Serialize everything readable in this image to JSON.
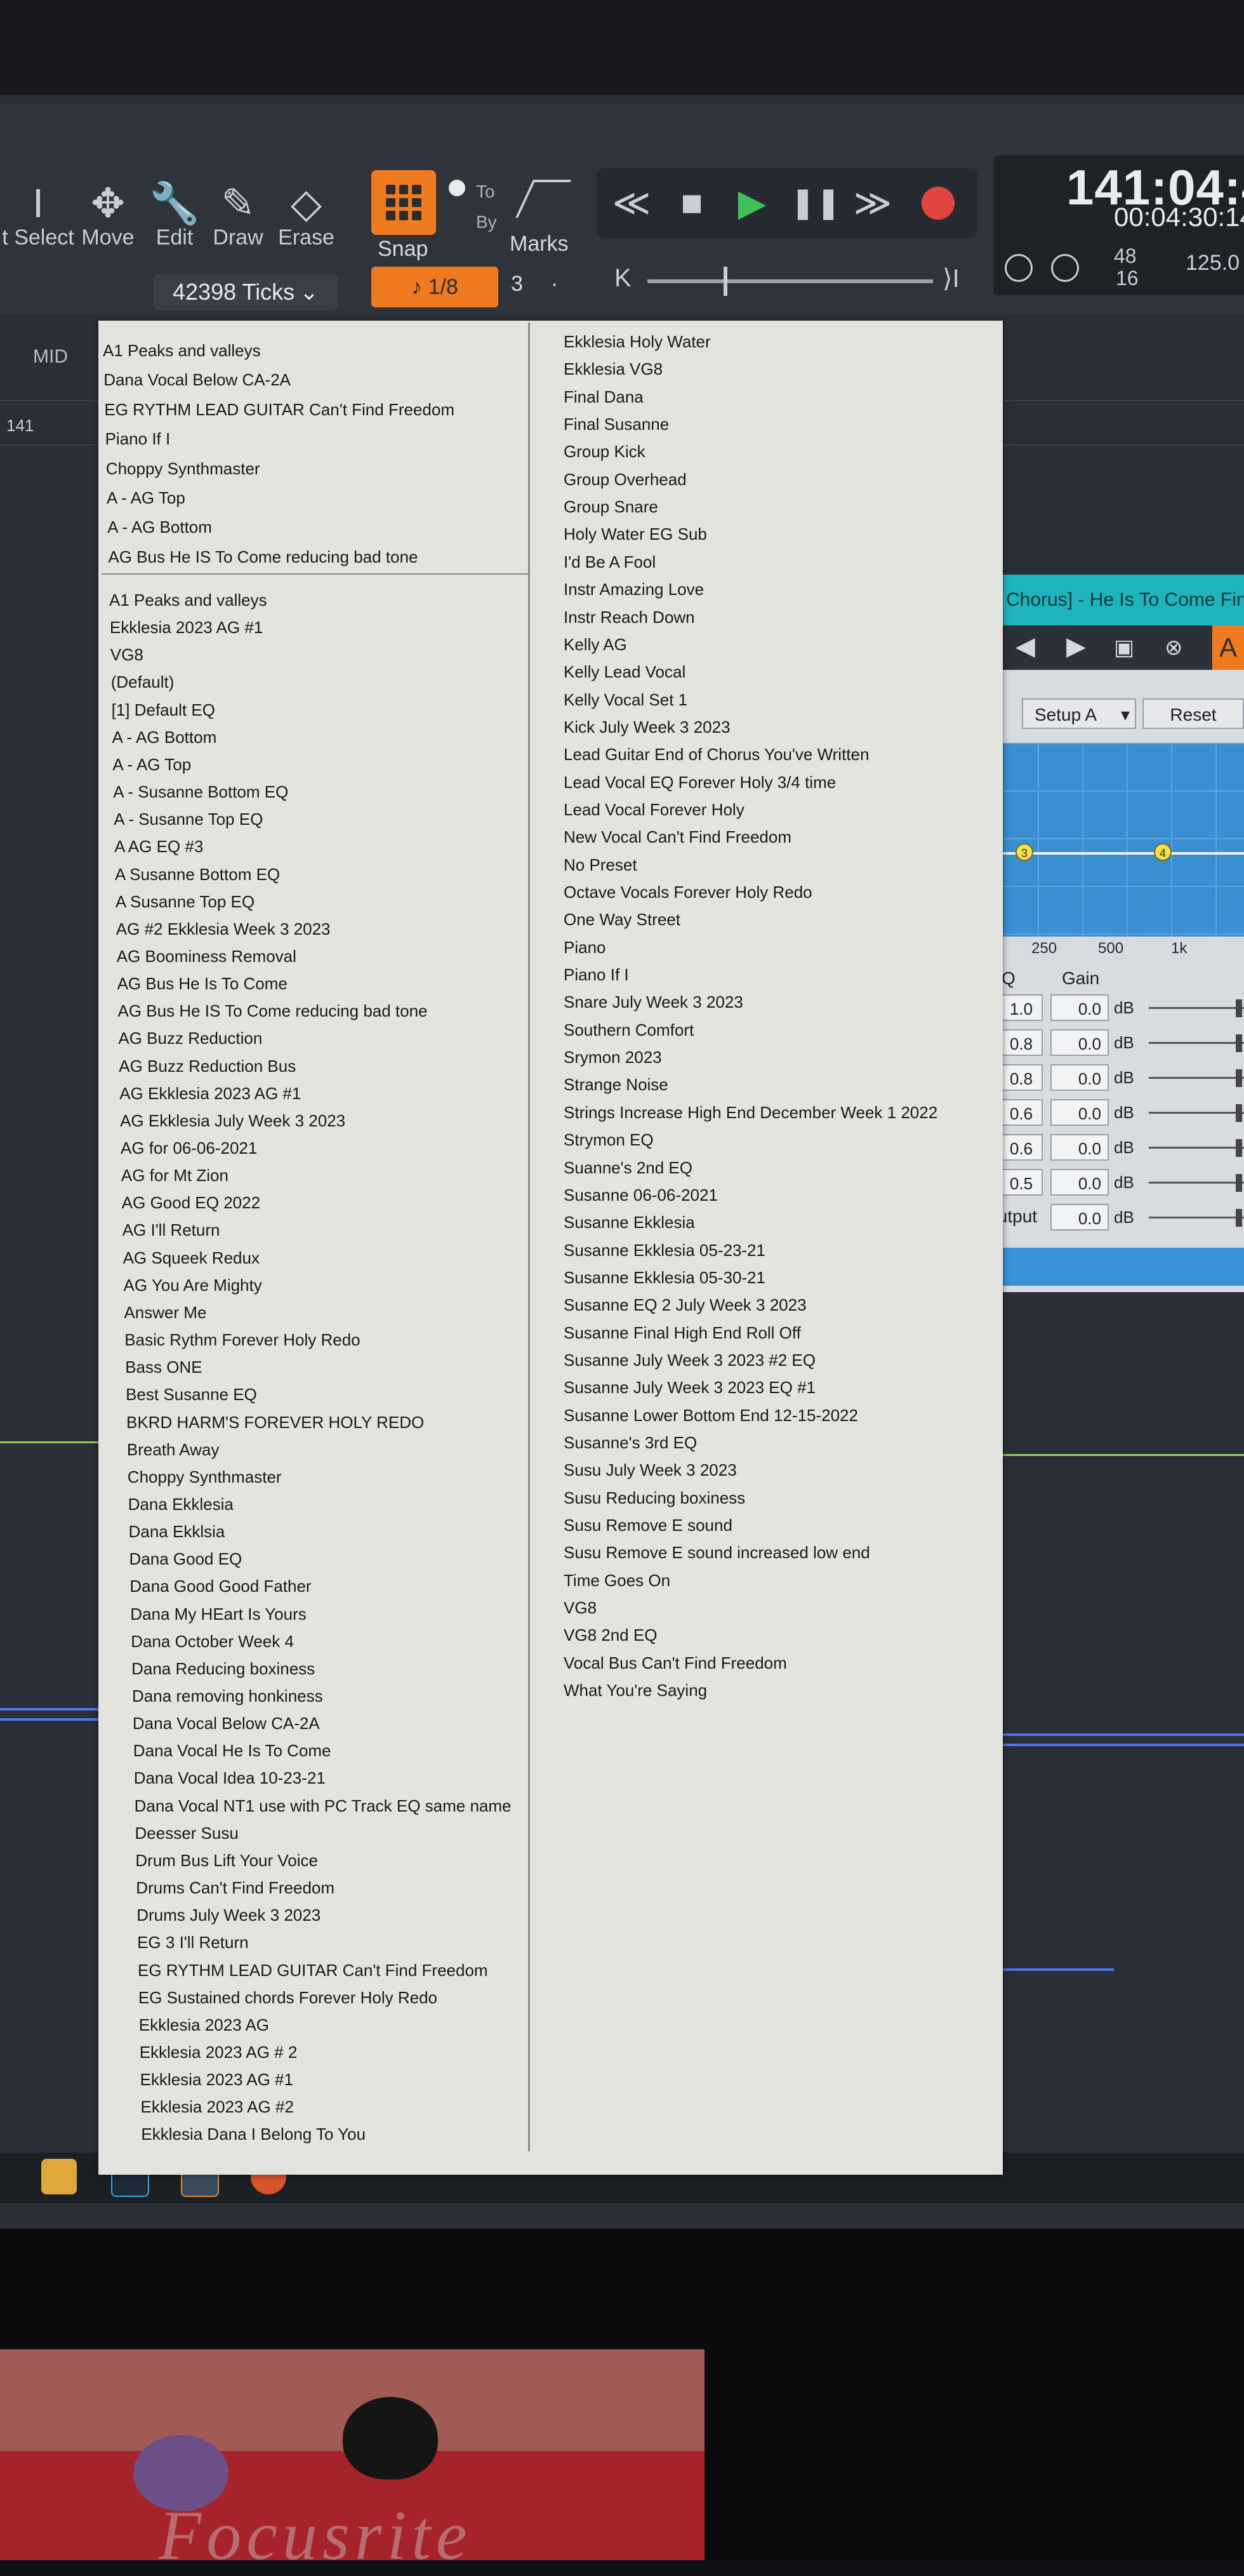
{
  "toolbar": {
    "tools": [
      {
        "label": "t Select",
        "icon": "text-cursor-icon"
      },
      {
        "label": "Move",
        "icon": "move-icon"
      },
      {
        "label": "Edit",
        "icon": "wrench-icon"
      },
      {
        "label": "Draw",
        "icon": "pencil-icon"
      },
      {
        "label": "Erase",
        "icon": "eraser-icon"
      }
    ],
    "snap_label": "Snap",
    "ticks_value": "42398 Ticks",
    "quantize_value": "♪ 1/8",
    "to_label": "To",
    "by_label": "By",
    "marks_label": "Marks",
    "marks_value": "3",
    "marks_dot": "·"
  },
  "transport": {
    "rewind": "≪",
    "stop": "■",
    "play": "▶",
    "pause": "❚❚",
    "fast_forward": "≫",
    "scrub_start": "K",
    "scrub_end": "⟩I"
  },
  "time_display": {
    "bars": "141:04:4",
    "clock": "00:04:30:14",
    "time_sig_top": "48",
    "time_sig_bottom": "16",
    "tempo": "125.0"
  },
  "arrange": {
    "mid_label": "MID",
    "bar_number": "141"
  },
  "eq_window": {
    "title": "Chorus] - He Is To Come Final",
    "setup_label": "Setup A",
    "setup_arrow": "▾",
    "reset_label": "Reset",
    "orange_tab": "A",
    "freq_labels": [
      "250",
      "500",
      "1k"
    ],
    "node_labels": [
      "3",
      "4"
    ],
    "q_header": "Q",
    "gain_header": "Gain",
    "bands": [
      {
        "q": "1.0",
        "gain": "0.0",
        "unit": "dB"
      },
      {
        "q": "0.8",
        "gain": "0.0",
        "unit": "dB"
      },
      {
        "q": "0.8",
        "gain": "0.0",
        "unit": "dB"
      },
      {
        "q": "0.6",
        "gain": "0.0",
        "unit": "dB"
      },
      {
        "q": "0.6",
        "gain": "0.0",
        "unit": "dB"
      },
      {
        "q": "0.5",
        "gain": "0.0",
        "unit": "dB"
      }
    ],
    "output_label": "Output",
    "output_gain": "0.0",
    "output_unit": "dB"
  },
  "menu": {
    "recent": [
      "A1 Peaks and valleys",
      "Dana Vocal Below CA-2A",
      "EG RYTHM  LEAD GUITAR Can't Find Freedom",
      "Piano If I",
      "Choppy Synthmaster",
      "A - AG Top",
      "A - AG Bottom",
      "AG Bus He IS To Come reducing bad tone"
    ],
    "column1": [
      "A1 Peaks and valleys",
      "Ekklesia 2023 AG #1",
      "VG8",
      "(Default)",
      "[1] Default EQ",
      "A - AG Bottom",
      "A - AG Top",
      "A - Susanne Bottom EQ",
      "A - Susanne Top EQ",
      "A AG EQ #3",
      "A Susanne Bottom EQ",
      "A Susanne Top EQ",
      "AG #2 Ekklesia Week 3 2023",
      "AG Boominess Removal",
      "AG Bus He Is To Come",
      "AG Bus He IS To Come reducing bad tone",
      "AG Buzz Reduction",
      "AG Buzz Reduction Bus",
      "AG Ekklesia 2023 AG #1",
      "AG Ekklesia July Week 3 2023",
      "AG for 06-06-2021",
      "AG for Mt Zion",
      "AG Good EQ 2022",
      "AG I'll Return",
      "AG Squeek Redux",
      "AG You Are Mighty",
      "Answer Me",
      "Basic Rythm Forever Holy Redo",
      "Bass ONE",
      "Best Susanne EQ",
      "BKRD HARM'S FOREVER HOLY REDO",
      "Breath Away",
      "Choppy Synthmaster",
      "Dana Ekklesia",
      "Dana Ekklsia",
      "Dana Good EQ",
      "Dana Good Good Father",
      "Dana My HEart Is Yours",
      "Dana October Week 4",
      "Dana Reducing boxiness",
      "Dana removing honkiness",
      "Dana Vocal Below CA-2A",
      "Dana Vocal He Is To Come",
      "Dana Vocal Idea 10-23-21",
      "Dana Vocal NT1 use with PC Track EQ same name",
      "Deesser Susu",
      "Drum Bus Lift Your Voice",
      "Drums Can't Find Freedom",
      "Drums July Week 3 2023",
      "EG 3 I'll Return",
      "EG RYTHM  LEAD GUITAR Can't Find Freedom",
      "EG Sustained chords Forever Holy Redo",
      "Ekklesia 2023 AG",
      "Ekklesia 2023 AG # 2",
      "Ekklesia 2023 AG #1",
      "Ekklesia 2023 AG #2",
      "Ekklesia Dana I Belong To You"
    ],
    "column2": [
      "Ekklesia Holy Water",
      "Ekklesia VG8",
      "Final Dana",
      "Final Susanne",
      "Group Kick",
      "Group Overhead",
      "Group Snare",
      "Holy Water EG Sub",
      "I'd Be A Fool",
      "Instr Amazing Love",
      "Instr Reach Down",
      "Kelly AG",
      "Kelly Lead Vocal",
      "Kelly Vocal Set 1",
      "Kick July Week 3 2023",
      "Lead Guitar End of Chorus You've Written",
      "Lead Vocal EQ Forever Holy 3/4 time",
      "Lead Vocal Forever Holy",
      "New Vocal Can't Find Freedom",
      "No Preset",
      "Octave Vocals Forever Holy Redo",
      "One Way Street",
      "Piano",
      "Piano If I",
      "Snare July Week 3 2023",
      "Southern Comfort",
      "Srymon 2023",
      "Strange Noise",
      "Strings Increase High End December Week 1 2022",
      "Strymon EQ",
      "Suanne's 2nd EQ",
      "Susanne 06-06-2021",
      "Susanne Ekklesia",
      "Susanne Ekklesia 05-23-21",
      "Susanne Ekklesia 05-30-21",
      "Susanne EQ 2 July Week 3 2023",
      "Susanne Final High End Roll Off",
      "Susanne July Week 3 2023 #2 EQ",
      "Susanne July Week 3 2023 EQ #1",
      "Susanne Lower Bottom End 12-15-2022",
      "Susanne's 3rd EQ",
      "Susu July Week 3 2023",
      "Susu Reducing boxiness",
      "Susu Remove E sound",
      "Susu Remove E sound increased low end",
      "Time Goes On",
      "VG8",
      "VG8 2nd EQ",
      "Vocal Bus Can't Find Freedom",
      "What You're Saying"
    ]
  },
  "desk": {
    "brand_text": "Focusrite"
  }
}
